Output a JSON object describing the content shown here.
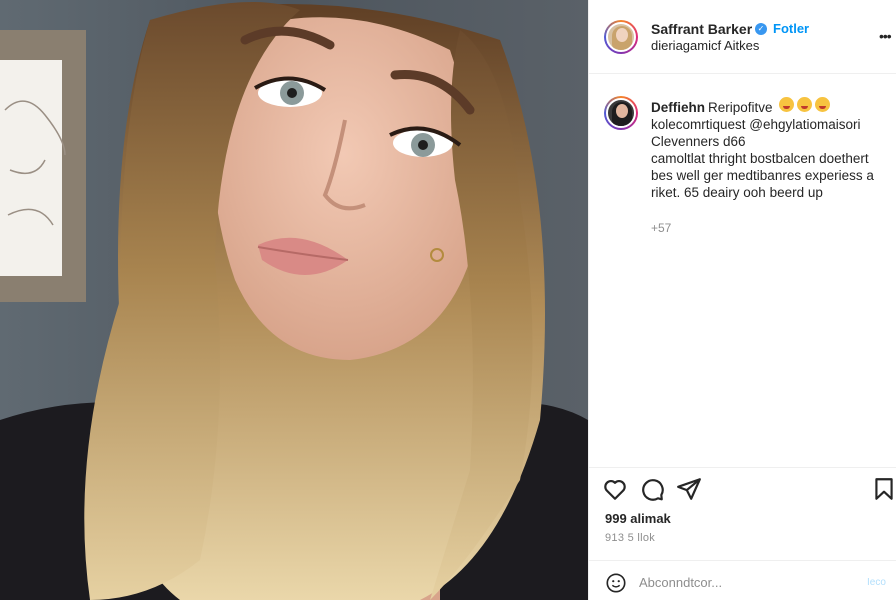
{
  "post": {
    "image_alt": "selfie",
    "author": {
      "username": "Saffrant Barker",
      "follow_label": "Fotler",
      "subtitle": "dieriagamicf Aitkes",
      "avatar_icon": "avatar-icon"
    },
    "comment": {
      "username": "Deffiehn",
      "head_rest": "Reripofitve",
      "lines": [
        "kolecomrtiquest @ehgylatiomaisori",
        "Clevenners d66",
        "camoltlat thright bostbalcen doethert",
        "bes well ger medtibanres experiess a",
        "riket. 65 deairy ooh beerd up"
      ],
      "time": "+57"
    },
    "actions": {
      "like_icon": "heart-icon",
      "comment_icon": "comment-bubble-icon",
      "share_icon": "paper-plane-icon",
      "save_icon": "bookmark-icon"
    },
    "likes": "999 alimak",
    "date": "913 5 llok",
    "add_comment": {
      "placeholder": "Abconndtcor...",
      "post_label": "Ieco"
    }
  },
  "colors": {
    "link": "#0095f6",
    "verified": "#3897f0",
    "muted": "#8e8e8e",
    "text": "#262626"
  }
}
